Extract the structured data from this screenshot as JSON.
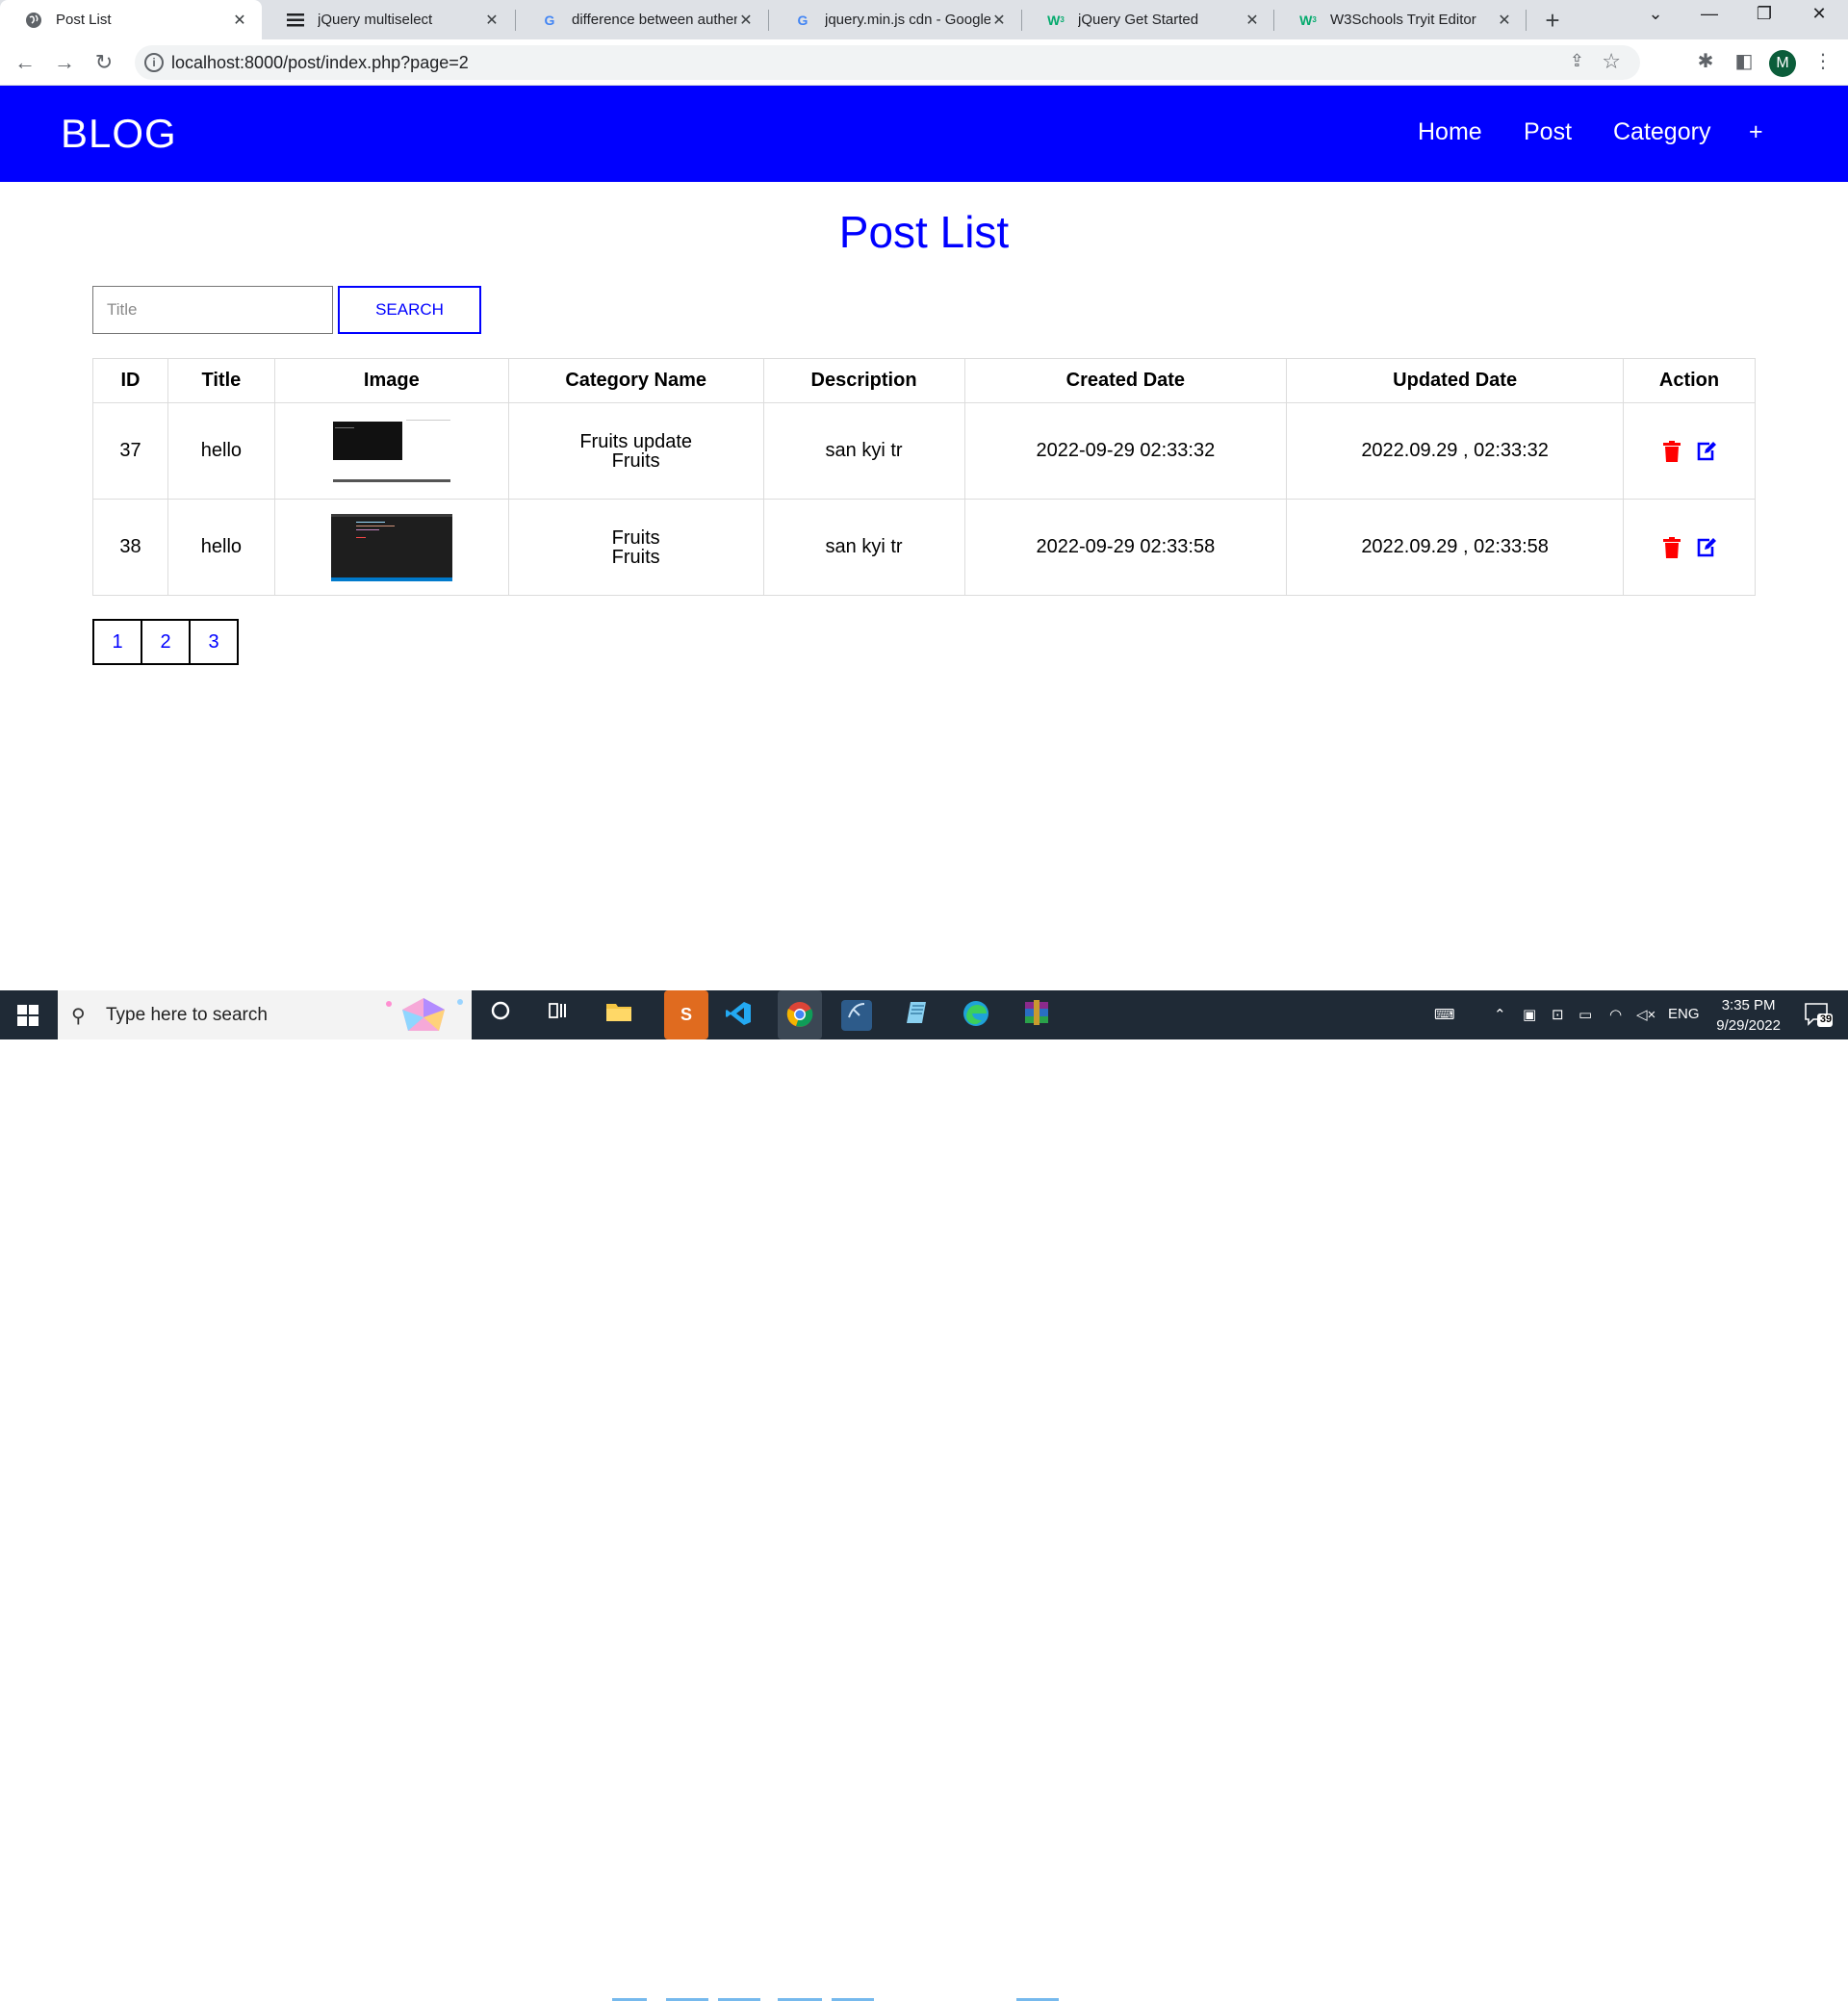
{
  "browser": {
    "tabs": [
      {
        "title": "Post List",
        "icon": "globe-icon"
      },
      {
        "title": "jQuery multiselect",
        "icon": "menu-lines-icon"
      },
      {
        "title": "difference between authent",
        "icon": "google-g-icon"
      },
      {
        "title": "jquery.min.js cdn - Google S",
        "icon": "google-g-icon"
      },
      {
        "title": "jQuery Get Started",
        "icon": "w3schools-icon"
      },
      {
        "title": "W3Schools Tryit Editor",
        "icon": "w3schools-icon"
      }
    ],
    "url": "localhost:8000/post/index.php?page=2",
    "profile_initial": "M"
  },
  "navbar": {
    "brand": "BLOG",
    "links": [
      "Home",
      "Post",
      "Category",
      "+"
    ],
    "color": "#0000ff"
  },
  "page": {
    "title": "Post List",
    "search": {
      "placeholder": "Title",
      "button": "SEARCH"
    }
  },
  "table": {
    "headers": [
      "ID",
      "Title",
      "Image",
      "Category Name",
      "Description",
      "Created Date",
      "Updated Date",
      "Action"
    ],
    "rows": [
      {
        "id": "37",
        "title": "hello",
        "categories": [
          "Fruits update",
          "Fruits"
        ],
        "description": "san kyi tr",
        "created": "2022-09-29 02:33:32",
        "updated": "2022.09.29 , 02:33:32"
      },
      {
        "id": "38",
        "title": "hello",
        "categories": [
          "Fruits",
          "Fruits"
        ],
        "description": "san kyi tr",
        "created": "2022-09-29 02:33:58",
        "updated": "2022.09.29 , 02:33:58"
      }
    ],
    "action_icons": [
      "trash-icon",
      "edit-icon"
    ],
    "action_colors": {
      "delete": "#ff0000",
      "edit": "#0000ff"
    }
  },
  "pagination": {
    "pages": [
      "1",
      "2",
      "3"
    ]
  },
  "taskbar": {
    "search_placeholder": "Type here to search",
    "tray": {
      "lang": "ENG",
      "time": "3:35 PM",
      "date": "9/29/2022",
      "notifications": "39"
    }
  }
}
